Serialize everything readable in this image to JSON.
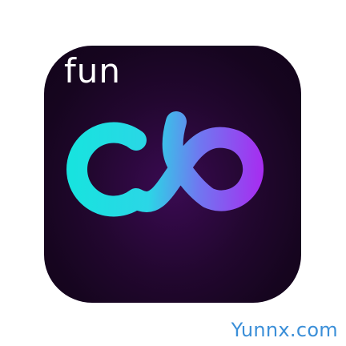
{
  "app_icon": {
    "label": "fun",
    "logo": "infinity-loop-logo",
    "colors": {
      "background": "#1a0624",
      "gradient_start": "#18e3df",
      "gradient_end": "#b31cf0"
    }
  },
  "watermark": {
    "text": "Yunnx.com",
    "color": "#3b8fd8"
  }
}
